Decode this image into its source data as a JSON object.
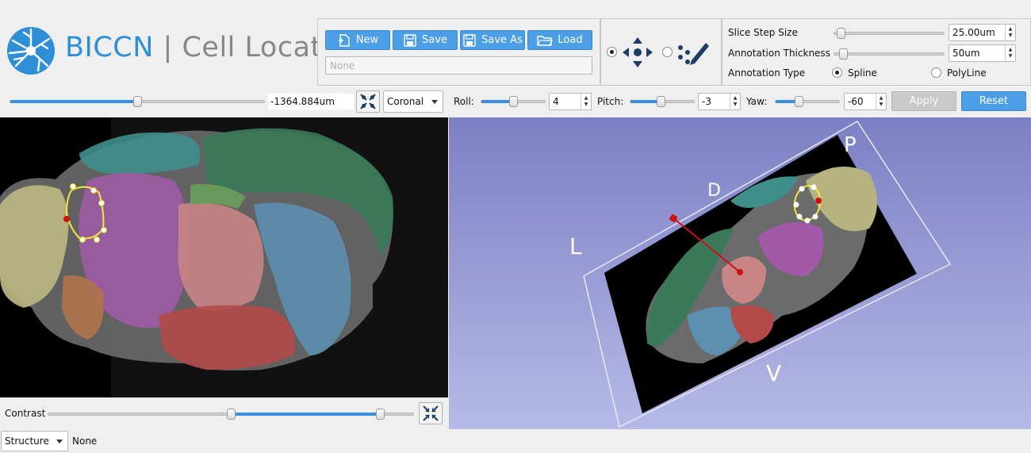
{
  "app": {
    "title_primary": "BICCN",
    "title_separator": "|",
    "title_secondary": "Cell Locator"
  },
  "file_toolbar": {
    "new_label": "New",
    "save_label": "Save",
    "save_as_label": "Save As",
    "load_label": "Load",
    "annotation_name_placeholder": "None"
  },
  "interaction_mode": {
    "selected": "place-view"
  },
  "annotation_settings": {
    "slice_step_label": "Slice Step Size",
    "slice_step_value": "25.00um",
    "slice_step_slider": 0.02,
    "thickness_label": "Annotation Thickness",
    "thickness_value": "50um",
    "thickness_slider": 0.05,
    "type_label": "Annotation Type",
    "type_spline": "Spline",
    "type_polyline": "PolyLine",
    "type_selected": "Spline"
  },
  "slice_bar": {
    "offset_value": "-1364.884um",
    "offset_slider": 0.5,
    "orientation": "Coronal",
    "roll_label": "Roll:",
    "roll_value": "4",
    "roll_slider": 0.5,
    "pitch_label": "Pitch:",
    "pitch_value": "-3",
    "pitch_slider": 0.48,
    "yaw_label": "Yaw:",
    "yaw_value": "-60",
    "yaw_slider": 0.35,
    "apply_label": "Apply",
    "reset_label": "Reset"
  },
  "bottom_bar": {
    "contrast_label": "Contrast",
    "contrast_low": 0.5,
    "contrast_high": 0.92,
    "structure_combo": "Structure",
    "structure_value": "None"
  },
  "view3d": {
    "label_d": "D",
    "label_p": "P",
    "label_l": "L",
    "label_v": "V"
  },
  "colors": {
    "accent": "#4c9ee6",
    "logo_blue": "#2e8fd6",
    "spline": "#f2ea3a",
    "marker": "#d01010"
  }
}
